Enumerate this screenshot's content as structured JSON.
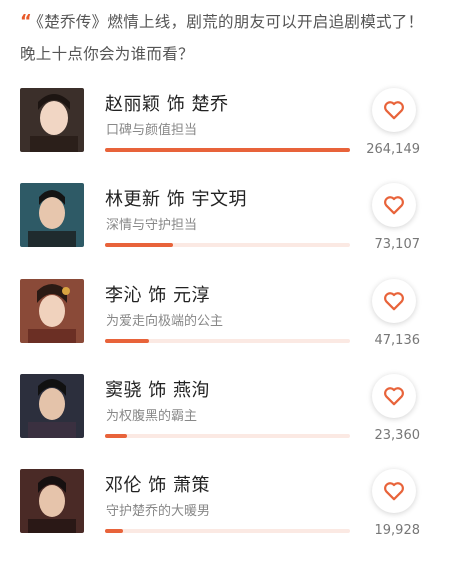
{
  "question": {
    "quote_mark": "“",
    "text": "《楚乔传》燃情上线，剧荒的朋友可以开启追剧模式了！晚上十点你会为谁而看？"
  },
  "accent_color": "#e8633a",
  "candidates": [
    {
      "name": "赵丽颖 饰 楚乔",
      "desc": "口碑与颜值担当",
      "count": "264,149",
      "share": 1.0,
      "icon": "heart-icon"
    },
    {
      "name": "林更新 饰 宇文玥",
      "desc": "深情与守护担当",
      "count": "73,107",
      "share": 0.277,
      "icon": "heart-icon"
    },
    {
      "name": "李沁 饰 元淳",
      "desc": "为爱走向极端的公主",
      "count": "47,136",
      "share": 0.178,
      "icon": "heart-icon"
    },
    {
      "name": "窦骁 饰 燕洵",
      "desc": "为权腹黑的霸主",
      "count": "23,360",
      "share": 0.088,
      "icon": "heart-icon"
    },
    {
      "name": "邓伦 饰 萧策",
      "desc": "守护楚乔的大暖男",
      "count": "19,928",
      "share": 0.075,
      "icon": "heart-icon"
    }
  ]
}
